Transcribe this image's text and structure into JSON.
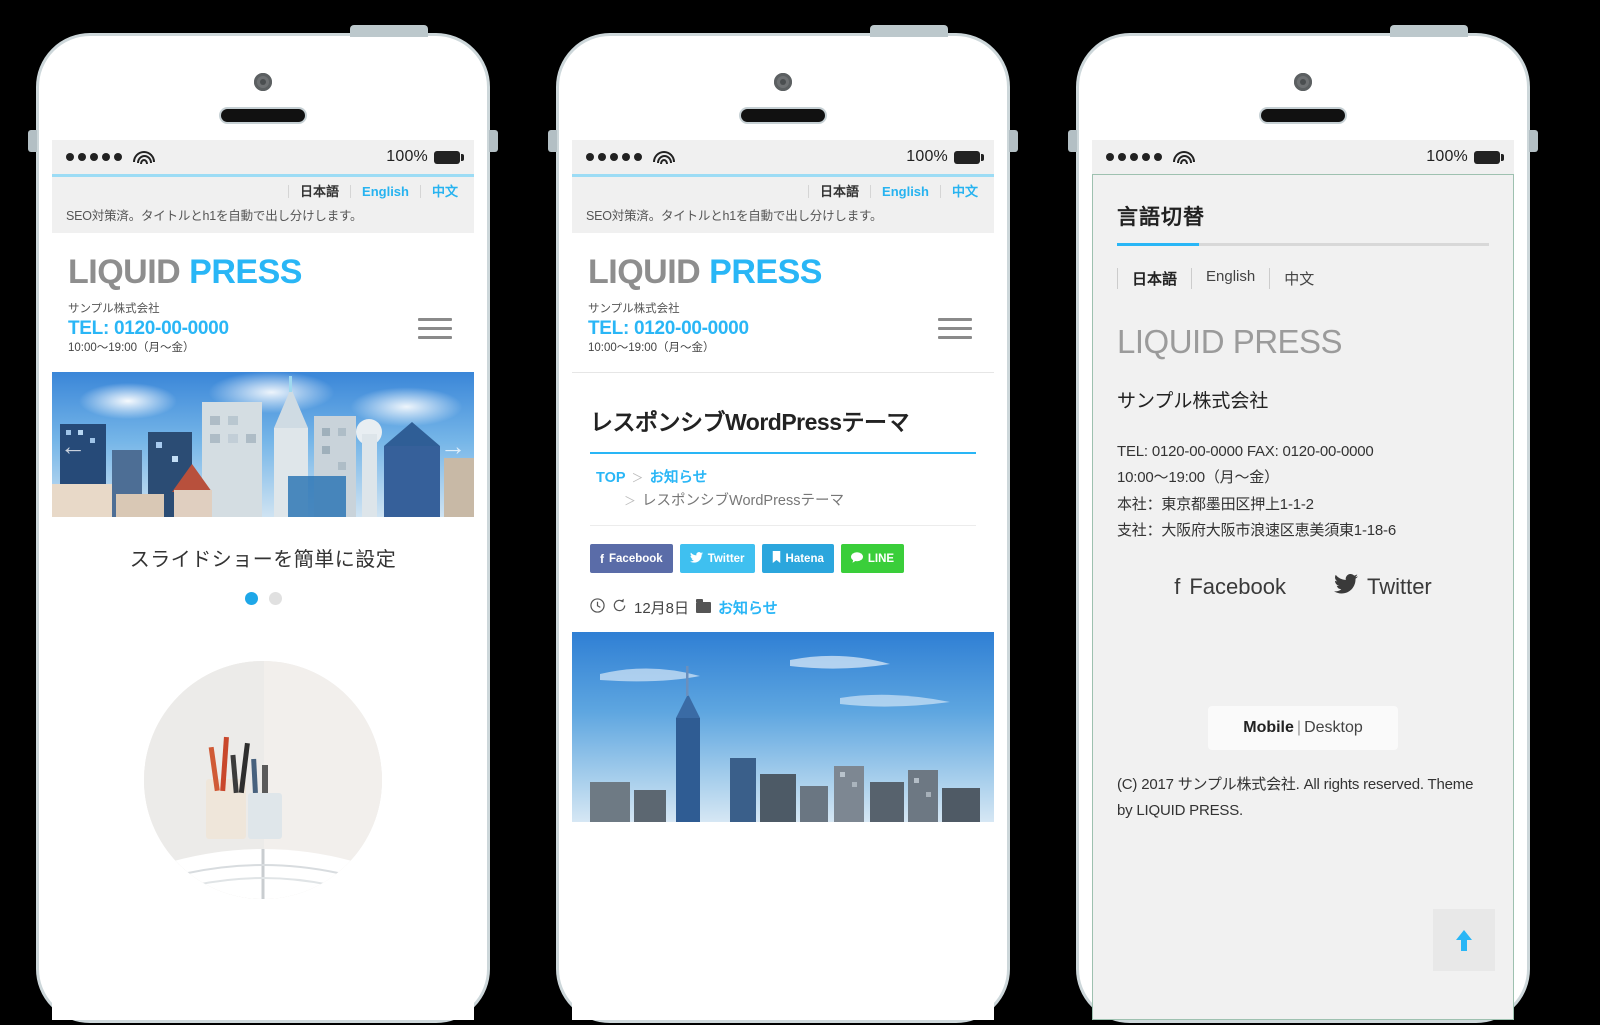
{
  "status_bar": {
    "battery_percent": "100%",
    "signal_dots": 5
  },
  "site_header": {
    "languages": [
      {
        "label": "日本語",
        "active": true
      },
      {
        "label": "English",
        "active": false
      },
      {
        "label": "中文",
        "active": false
      }
    ],
    "seo_note": "SEO対策済。タイトルとh1を自動で出し分けします。",
    "logo_part1": "LIQUID",
    "logo_part2": "PRESS",
    "company": "サンプル株式会社",
    "tel": "TEL: 0120-00-0000",
    "hours": "10:00〜19:00（月〜金）",
    "menu_icon": "hamburger-icon"
  },
  "phone1": {
    "slide_caption": "スライドショーを簡単に設定",
    "prev_arrow": "←",
    "next_arrow": "→",
    "dots": [
      {
        "active": true
      },
      {
        "active": false
      }
    ]
  },
  "phone2": {
    "article_title": "レスポンシブWordPressテーマ",
    "breadcrumb": {
      "top": "TOP",
      "category": "お知らせ",
      "current": "レスポンシブWordPressテーマ",
      "separator": "＞"
    },
    "share_buttons": [
      {
        "label": "Facebook",
        "glyph": "f",
        "color": "#5a6ca8"
      },
      {
        "label": "Twitter",
        "glyph": "🐦",
        "color": "#3fc0f0"
      },
      {
        "label": "Hatena",
        "glyph": "🔖",
        "color": "#2ba6dd"
      },
      {
        "label": "LINE",
        "glyph": "💬",
        "color": "#3ace3a"
      }
    ],
    "post_meta": {
      "clock_icon": "clock-icon",
      "update_icon": "refresh-icon",
      "date": "12月8日",
      "folder_icon": "folder-icon",
      "category": "お知らせ"
    }
  },
  "phone3": {
    "panel_title": "言語切替",
    "languages": [
      {
        "label": "日本語",
        "active": true
      },
      {
        "label": "English",
        "active": false
      },
      {
        "label": "中文",
        "active": false
      }
    ],
    "logo": "LIQUID PRESS",
    "company": "サンプル株式会社",
    "info_lines": [
      "TEL: 0120-00-0000 FAX: 0120-00-0000",
      "10:00〜19:00（月〜金）",
      "本社：東京都墨田区押上1-1-2",
      "支社：大阪府大阪市浪速区恵美須東1-18-6"
    ],
    "social": [
      {
        "label": "Facebook",
        "glyph": "f"
      },
      {
        "label": "Twitter",
        "glyph": "🐦"
      }
    ],
    "view_switch": {
      "mobile": "Mobile",
      "separator": "|",
      "desktop": "Desktop"
    },
    "copyright": "(C) 2017 サンプル株式会社. All rights reserved. Theme by LIQUID PRESS.",
    "to_top_icon": "arrow-up-icon"
  },
  "colors": {
    "accent": "#29b6f6",
    "logo_gray": "#8e8e8e",
    "bezel": "#cdd7da",
    "background": "#000000"
  }
}
